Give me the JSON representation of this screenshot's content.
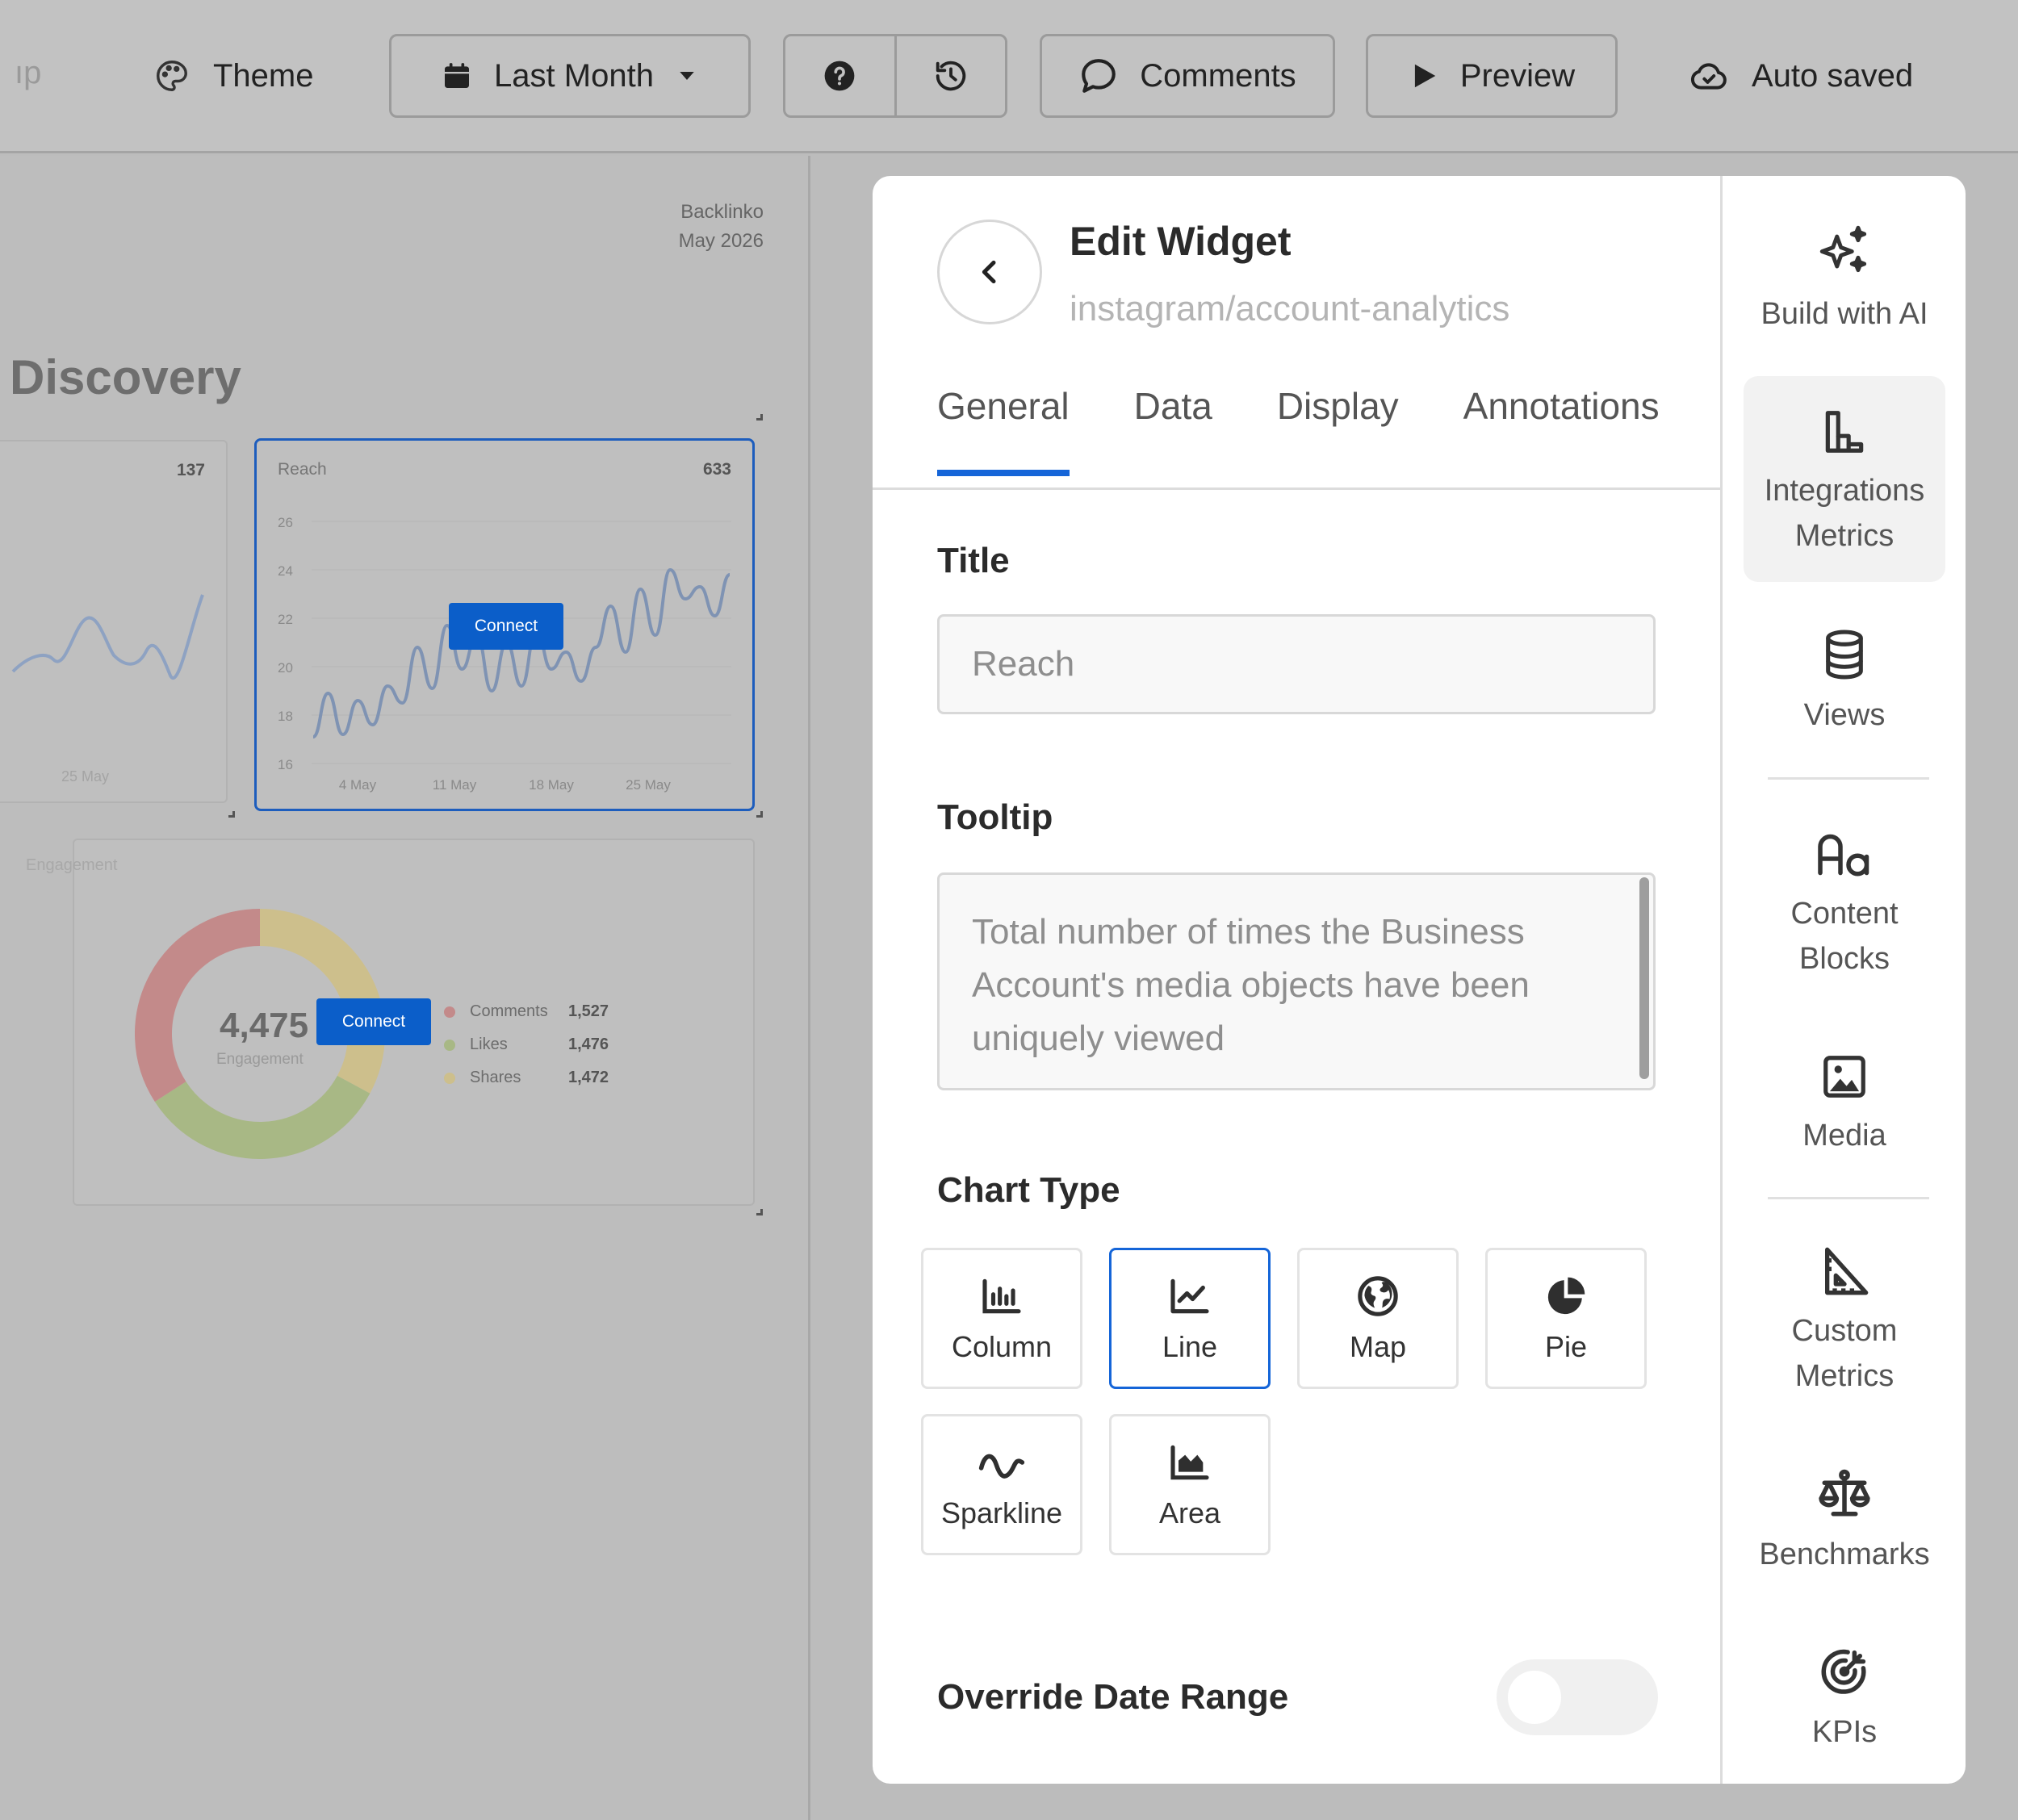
{
  "toolbar": {
    "truncated_label": "ıp",
    "theme_label": "Theme",
    "date_range_label": "Last Month",
    "comments_label": "Comments",
    "preview_label": "Preview",
    "autosave_label": "Auto saved"
  },
  "report": {
    "brand": "Backlinko",
    "period": "May 2026",
    "section_title": "Discovery",
    "left_card": {
      "value": "137",
      "x_tick": "25 May"
    },
    "reach_card": {
      "title": "Reach",
      "value": "633",
      "connect_label": "Connect",
      "chart_data": {
        "type": "line",
        "title": "Reach",
        "x_ticks": [
          "4 May",
          "11 May",
          "18 May",
          "25 May"
        ],
        "y_ticks": [
          16,
          18,
          20,
          22,
          24,
          26
        ],
        "ylim": [
          16,
          26
        ],
        "series": [
          {
            "values": [
              17.1,
              18.9,
              17.2,
              18.6,
              17.6,
              19.2,
              18.5,
              20.8,
              19.1,
              21.7,
              19.9,
              21.3,
              19.0,
              21.0,
              19.2,
              21.5,
              19.9,
              20.6,
              19.4,
              20.8,
              22.5,
              20.6,
              23.2,
              21.3,
              24.0,
              22.8,
              23.3,
              22.1,
              23.8
            ]
          }
        ],
        "color": "#7f93b3"
      }
    },
    "engagement_card": {
      "title": "Engagement",
      "total": "4,475",
      "total_label": "Engagement",
      "connect_label": "Connect",
      "chart_data": {
        "type": "pie",
        "title": "Engagement",
        "series": [
          {
            "name": "Comments",
            "value": 1527,
            "label": "1,527",
            "color": "#c38a8a"
          },
          {
            "name": "Likes",
            "value": 1476,
            "label": "1,476",
            "color": "#a8b885"
          },
          {
            "name": "Shares",
            "value": 1472,
            "label": "1,472",
            "color": "#cdbf8c"
          }
        ]
      }
    }
  },
  "panel": {
    "title": "Edit Widget",
    "subtitle": "instagram/account-analytics",
    "tabs": [
      {
        "label": "General",
        "active": true
      },
      {
        "label": "Data"
      },
      {
        "label": "Display"
      },
      {
        "label": "Annotations"
      }
    ],
    "fields": {
      "title_label": "Title",
      "title_value": "Reach",
      "tooltip_label": "Tooltip",
      "tooltip_value": "Total number of times the Business Account's media objects have been uniquely viewed",
      "chart_type_label": "Chart Type",
      "override_label": "Override Date Range",
      "override_enabled": false
    },
    "chart_types": [
      {
        "label": "Column",
        "icon": "column-chart-icon"
      },
      {
        "label": "Line",
        "icon": "line-chart-icon",
        "selected": true
      },
      {
        "label": "Map",
        "icon": "globe-icon"
      },
      {
        "label": "Pie",
        "icon": "pie-chart-icon"
      },
      {
        "label": "Sparkline",
        "icon": "sparkline-icon"
      },
      {
        "label": "Area",
        "icon": "area-chart-icon"
      }
    ]
  },
  "rail": {
    "items": [
      {
        "label": "Build with AI",
        "icon": "sparkles-icon"
      },
      {
        "label": "Integrations Metrics",
        "icon": "integrations-chart-icon",
        "active": true
      },
      {
        "label": "Views",
        "icon": "database-icon"
      },
      {
        "label": "Content Blocks",
        "icon": "typography-icon"
      },
      {
        "label": "Media",
        "icon": "image-icon"
      },
      {
        "label": "Custom Metrics",
        "icon": "ruler-triangle-icon"
      },
      {
        "label": "Benchmarks",
        "icon": "scale-icon"
      },
      {
        "label": "KPIs",
        "icon": "target-icon"
      }
    ]
  },
  "colors": {
    "accent": "#1565d8",
    "connect_button": "#0b5ec9",
    "overlay": "#bdbdbd"
  }
}
